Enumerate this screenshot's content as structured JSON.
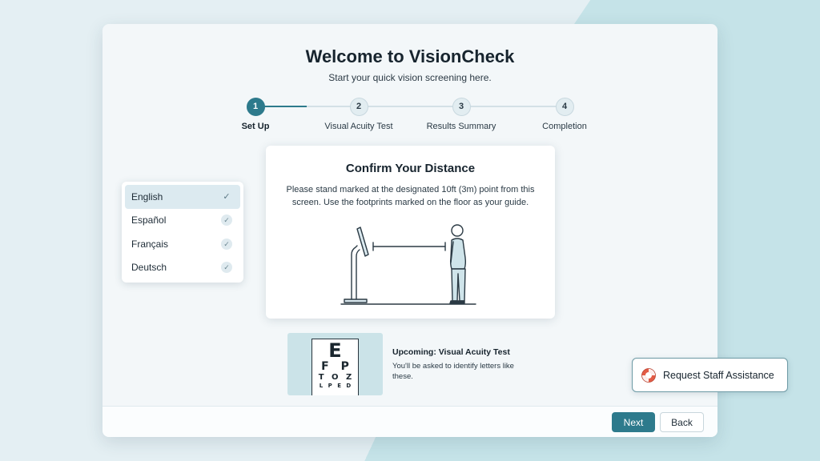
{
  "app": {
    "title": "Welcome to VisionCheck",
    "subtitle": "Start your quick vision screening here."
  },
  "stepper": {
    "current": 1,
    "steps": [
      {
        "number": "1",
        "label": "Set Up"
      },
      {
        "number": "2",
        "label": "Visual Acuity Test"
      },
      {
        "number": "3",
        "label": "Results Summary"
      },
      {
        "number": "4",
        "label": "Completion"
      }
    ]
  },
  "language": {
    "selected": "English",
    "options": [
      {
        "label": "English"
      },
      {
        "label": "Español"
      },
      {
        "label": "Français"
      },
      {
        "label": "Deutsch"
      }
    ]
  },
  "distance_card": {
    "title": "Confirm Your Distance",
    "text": "Please stand marked at the designated 10ft (3m) point from this screen. Use the footprints marked on the floor as your guide.",
    "illustration_icon": "person-at-distance-from-kiosk"
  },
  "upcoming": {
    "title": "Upcoming: Visual Acuity Test",
    "description": "You'll be asked to identify letters like these.",
    "eye_chart": {
      "row1": "E",
      "row2": "F P",
      "row3": "T O Z",
      "row4": "L P E D"
    }
  },
  "footer": {
    "next_label": "Next",
    "back_label": "Back"
  },
  "assistance": {
    "label": "Request Staff Assistance",
    "icon": "lifebuoy-icon"
  },
  "colors": {
    "accent": "#2d7a8c",
    "background": "#e4eff3",
    "panel": "#f3f7f9"
  }
}
